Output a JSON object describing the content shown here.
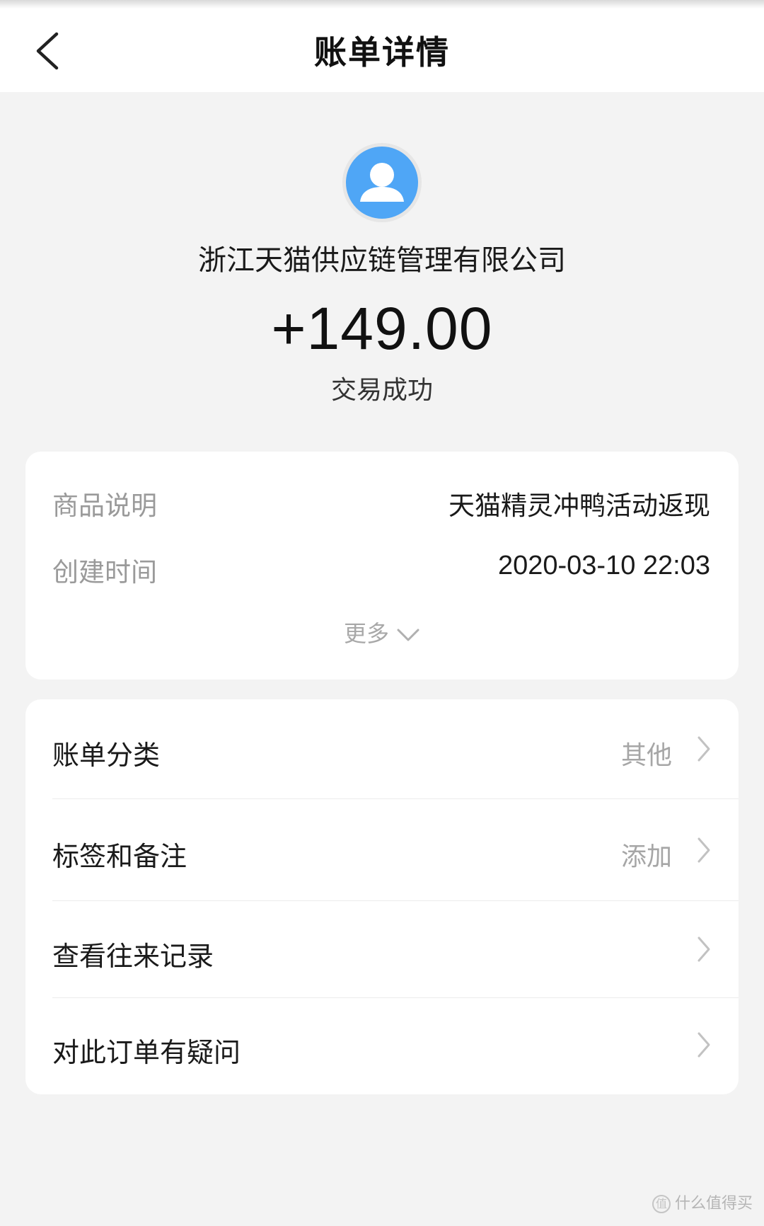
{
  "header": {
    "title": "账单详情",
    "back_icon": "chevron-left-icon"
  },
  "summary": {
    "avatar_icon": "user-avatar-icon",
    "merchant": "浙江天猫供应链管理有限公司",
    "amount": "+149.00",
    "status": "交易成功"
  },
  "details": {
    "rows": [
      {
        "label": "商品说明",
        "value": "天猫精灵冲鸭活动返现"
      },
      {
        "label": "创建时间",
        "value": "2020-03-10 22:03"
      }
    ],
    "more_label": "更多"
  },
  "actions": {
    "rows": [
      {
        "label": "账单分类",
        "value": "其他"
      },
      {
        "label": "标签和备注",
        "value": "添加"
      },
      {
        "label": "查看往来记录",
        "value": ""
      },
      {
        "label": "对此订单有疑问",
        "value": ""
      }
    ]
  },
  "watermark": {
    "text": "什么值得买",
    "badge": "值"
  },
  "colors": {
    "background": "#f3f3f3",
    "avatar": "#4fa6f6",
    "card": "#ffffff",
    "muted_text": "#9a9a9a"
  }
}
